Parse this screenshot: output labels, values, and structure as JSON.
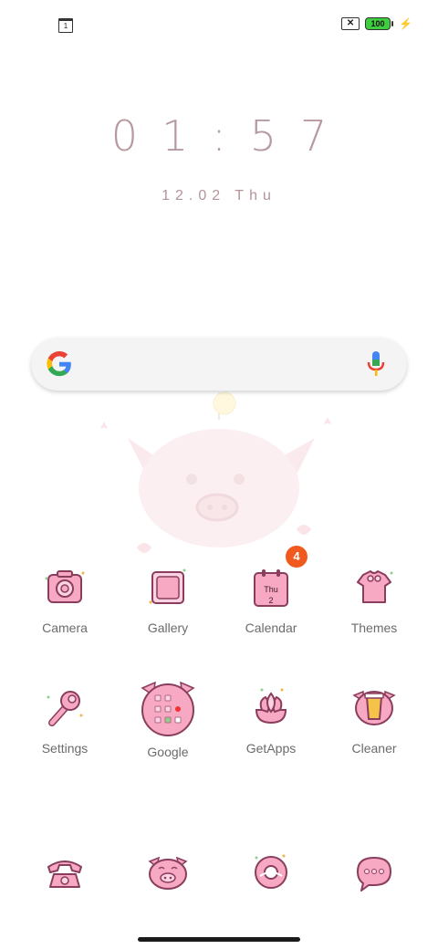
{
  "status": {
    "calendar_day": "1",
    "sim_status": "✕",
    "battery": "100"
  },
  "lockscreen": {
    "time": "01:57",
    "date": "12.02 Thu"
  },
  "apps": {
    "row1": [
      "Camera",
      "Gallery",
      "Calendar",
      "Themes"
    ],
    "row2": [
      "Settings",
      "Google",
      "GetApps",
      "Cleaner"
    ],
    "calendar_badge": "4",
    "calendar_icon_day": "Thu",
    "calendar_icon_date": "2"
  },
  "colors": {
    "icon_pink": "#f7a9c4",
    "icon_stroke": "#8a3d5c",
    "label": "#6b6b6b",
    "clock": "#b79aa0",
    "badge": "#f15a1e"
  }
}
